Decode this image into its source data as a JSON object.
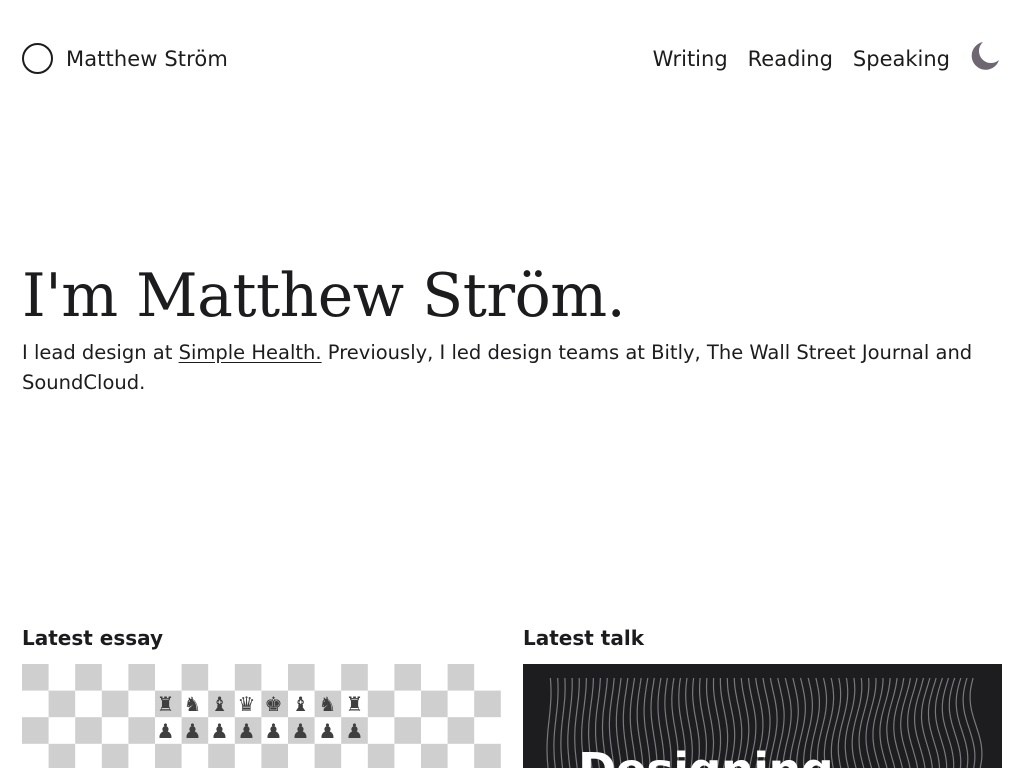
{
  "header": {
    "site_name": "Matthew Ström",
    "nav": [
      {
        "label": "Writing"
      },
      {
        "label": "Reading"
      },
      {
        "label": "Speaking"
      }
    ],
    "theme_icon": "moon-icon"
  },
  "hero": {
    "title": "I'm Matthew Ström.",
    "intro_before": "I lead design at ",
    "link_text": "Simple Health.",
    "intro_after": " Previously, I led design teams at Bitly, The Wall Street Journal and SoundCloud."
  },
  "latest_essay": {
    "label": "Latest essay",
    "image": "chessboard-image",
    "back_rank": [
      "♜",
      "♞",
      "♝",
      "♛",
      "♚",
      "♝",
      "♞",
      "♜"
    ],
    "pawn_rank": [
      "♟",
      "♟",
      "♟",
      "♟",
      "♟",
      "♟",
      "♟",
      "♟"
    ]
  },
  "latest_talk": {
    "label": "Latest talk",
    "title": "Designing"
  },
  "colors": {
    "text": "#1c1c1e",
    "moon": "#6e6670",
    "checker": "#cfcfcf",
    "talk_bg": "#1d1d20"
  }
}
